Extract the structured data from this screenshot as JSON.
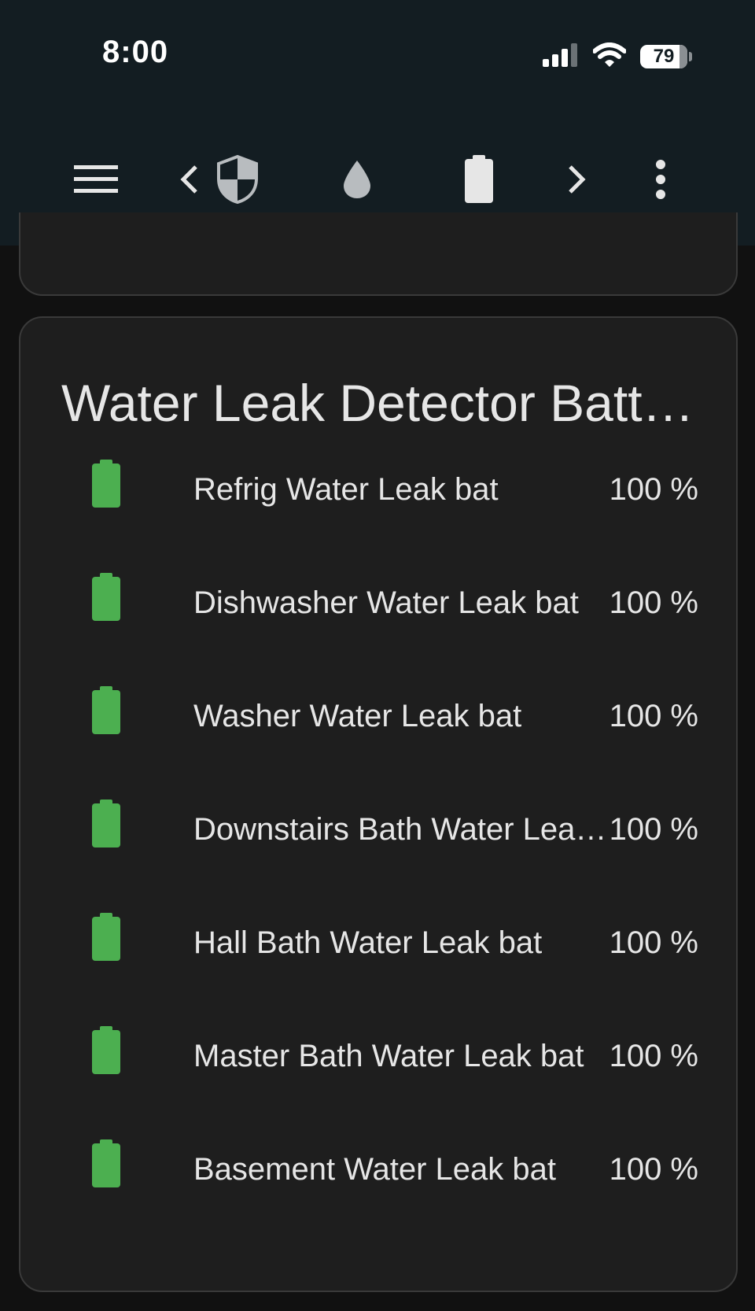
{
  "status_bar": {
    "time": "8:00",
    "battery_level": "79"
  },
  "toolbar": {
    "items": [
      {
        "icon": "menu-icon"
      },
      {
        "icon": "chevron-left-icon"
      },
      {
        "icon": "shield-icon"
      },
      {
        "icon": "water-drop-icon"
      },
      {
        "icon": "battery-icon",
        "selected": true
      },
      {
        "icon": "chevron-right-icon"
      },
      {
        "icon": "more-vert-icon"
      }
    ]
  },
  "card": {
    "title": "Water Leak Detector Batteries",
    "rows": [
      {
        "name": "Refrig Water Leak bat",
        "value": "100 %"
      },
      {
        "name": "Dishwasher Water Leak bat",
        "value": "100 %"
      },
      {
        "name": "Washer Water Leak bat",
        "value": "100 %"
      },
      {
        "name": "Downstairs Bath Water Leak bat",
        "value": "100 %"
      },
      {
        "name": "Hall Bath Water Leak bat",
        "value": "100 %"
      },
      {
        "name": "Master Bath Water Leak bat",
        "value": "100 %"
      },
      {
        "name": "Basement Water Leak bat",
        "value": "100 %"
      }
    ]
  },
  "colors": {
    "header_bg": "#131d22",
    "page_bg": "#111111",
    "card_bg": "#1e1e1e",
    "battery_green": "#4caf50"
  }
}
